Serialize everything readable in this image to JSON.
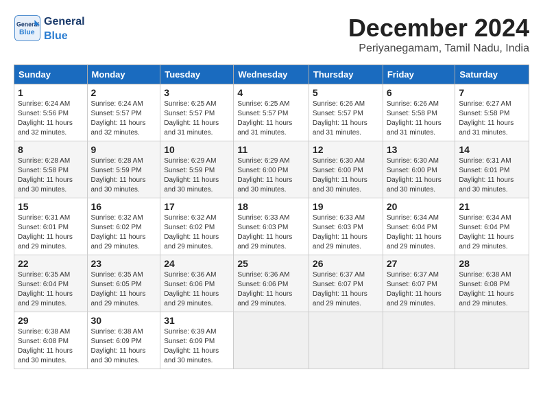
{
  "logo": {
    "general": "General",
    "blue": "Blue"
  },
  "title": "December 2024",
  "subtitle": "Periyanegamam, Tamil Nadu, India",
  "weekdays": [
    "Sunday",
    "Monday",
    "Tuesday",
    "Wednesday",
    "Thursday",
    "Friday",
    "Saturday"
  ],
  "weeks": [
    [
      {
        "day": "1",
        "info": "Sunrise: 6:24 AM\nSunset: 5:56 PM\nDaylight: 11 hours\nand 32 minutes."
      },
      {
        "day": "2",
        "info": "Sunrise: 6:24 AM\nSunset: 5:57 PM\nDaylight: 11 hours\nand 32 minutes."
      },
      {
        "day": "3",
        "info": "Sunrise: 6:25 AM\nSunset: 5:57 PM\nDaylight: 11 hours\nand 31 minutes."
      },
      {
        "day": "4",
        "info": "Sunrise: 6:25 AM\nSunset: 5:57 PM\nDaylight: 11 hours\nand 31 minutes."
      },
      {
        "day": "5",
        "info": "Sunrise: 6:26 AM\nSunset: 5:57 PM\nDaylight: 11 hours\nand 31 minutes."
      },
      {
        "day": "6",
        "info": "Sunrise: 6:26 AM\nSunset: 5:58 PM\nDaylight: 11 hours\nand 31 minutes."
      },
      {
        "day": "7",
        "info": "Sunrise: 6:27 AM\nSunset: 5:58 PM\nDaylight: 11 hours\nand 31 minutes."
      }
    ],
    [
      {
        "day": "8",
        "info": "Sunrise: 6:28 AM\nSunset: 5:58 PM\nDaylight: 11 hours\nand 30 minutes."
      },
      {
        "day": "9",
        "info": "Sunrise: 6:28 AM\nSunset: 5:59 PM\nDaylight: 11 hours\nand 30 minutes."
      },
      {
        "day": "10",
        "info": "Sunrise: 6:29 AM\nSunset: 5:59 PM\nDaylight: 11 hours\nand 30 minutes."
      },
      {
        "day": "11",
        "info": "Sunrise: 6:29 AM\nSunset: 6:00 PM\nDaylight: 11 hours\nand 30 minutes."
      },
      {
        "day": "12",
        "info": "Sunrise: 6:30 AM\nSunset: 6:00 PM\nDaylight: 11 hours\nand 30 minutes."
      },
      {
        "day": "13",
        "info": "Sunrise: 6:30 AM\nSunset: 6:00 PM\nDaylight: 11 hours\nand 30 minutes."
      },
      {
        "day": "14",
        "info": "Sunrise: 6:31 AM\nSunset: 6:01 PM\nDaylight: 11 hours\nand 30 minutes."
      }
    ],
    [
      {
        "day": "15",
        "info": "Sunrise: 6:31 AM\nSunset: 6:01 PM\nDaylight: 11 hours\nand 29 minutes."
      },
      {
        "day": "16",
        "info": "Sunrise: 6:32 AM\nSunset: 6:02 PM\nDaylight: 11 hours\nand 29 minutes."
      },
      {
        "day": "17",
        "info": "Sunrise: 6:32 AM\nSunset: 6:02 PM\nDaylight: 11 hours\nand 29 minutes."
      },
      {
        "day": "18",
        "info": "Sunrise: 6:33 AM\nSunset: 6:03 PM\nDaylight: 11 hours\nand 29 minutes."
      },
      {
        "day": "19",
        "info": "Sunrise: 6:33 AM\nSunset: 6:03 PM\nDaylight: 11 hours\nand 29 minutes."
      },
      {
        "day": "20",
        "info": "Sunrise: 6:34 AM\nSunset: 6:04 PM\nDaylight: 11 hours\nand 29 minutes."
      },
      {
        "day": "21",
        "info": "Sunrise: 6:34 AM\nSunset: 6:04 PM\nDaylight: 11 hours\nand 29 minutes."
      }
    ],
    [
      {
        "day": "22",
        "info": "Sunrise: 6:35 AM\nSunset: 6:04 PM\nDaylight: 11 hours\nand 29 minutes."
      },
      {
        "day": "23",
        "info": "Sunrise: 6:35 AM\nSunset: 6:05 PM\nDaylight: 11 hours\nand 29 minutes."
      },
      {
        "day": "24",
        "info": "Sunrise: 6:36 AM\nSunset: 6:06 PM\nDaylight: 11 hours\nand 29 minutes."
      },
      {
        "day": "25",
        "info": "Sunrise: 6:36 AM\nSunset: 6:06 PM\nDaylight: 11 hours\nand 29 minutes."
      },
      {
        "day": "26",
        "info": "Sunrise: 6:37 AM\nSunset: 6:07 PM\nDaylight: 11 hours\nand 29 minutes."
      },
      {
        "day": "27",
        "info": "Sunrise: 6:37 AM\nSunset: 6:07 PM\nDaylight: 11 hours\nand 29 minutes."
      },
      {
        "day": "28",
        "info": "Sunrise: 6:38 AM\nSunset: 6:08 PM\nDaylight: 11 hours\nand 29 minutes."
      }
    ],
    [
      {
        "day": "29",
        "info": "Sunrise: 6:38 AM\nSunset: 6:08 PM\nDaylight: 11 hours\nand 30 minutes."
      },
      {
        "day": "30",
        "info": "Sunrise: 6:38 AM\nSunset: 6:09 PM\nDaylight: 11 hours\nand 30 minutes."
      },
      {
        "day": "31",
        "info": "Sunrise: 6:39 AM\nSunset: 6:09 PM\nDaylight: 11 hours\nand 30 minutes."
      },
      null,
      null,
      null,
      null
    ]
  ]
}
